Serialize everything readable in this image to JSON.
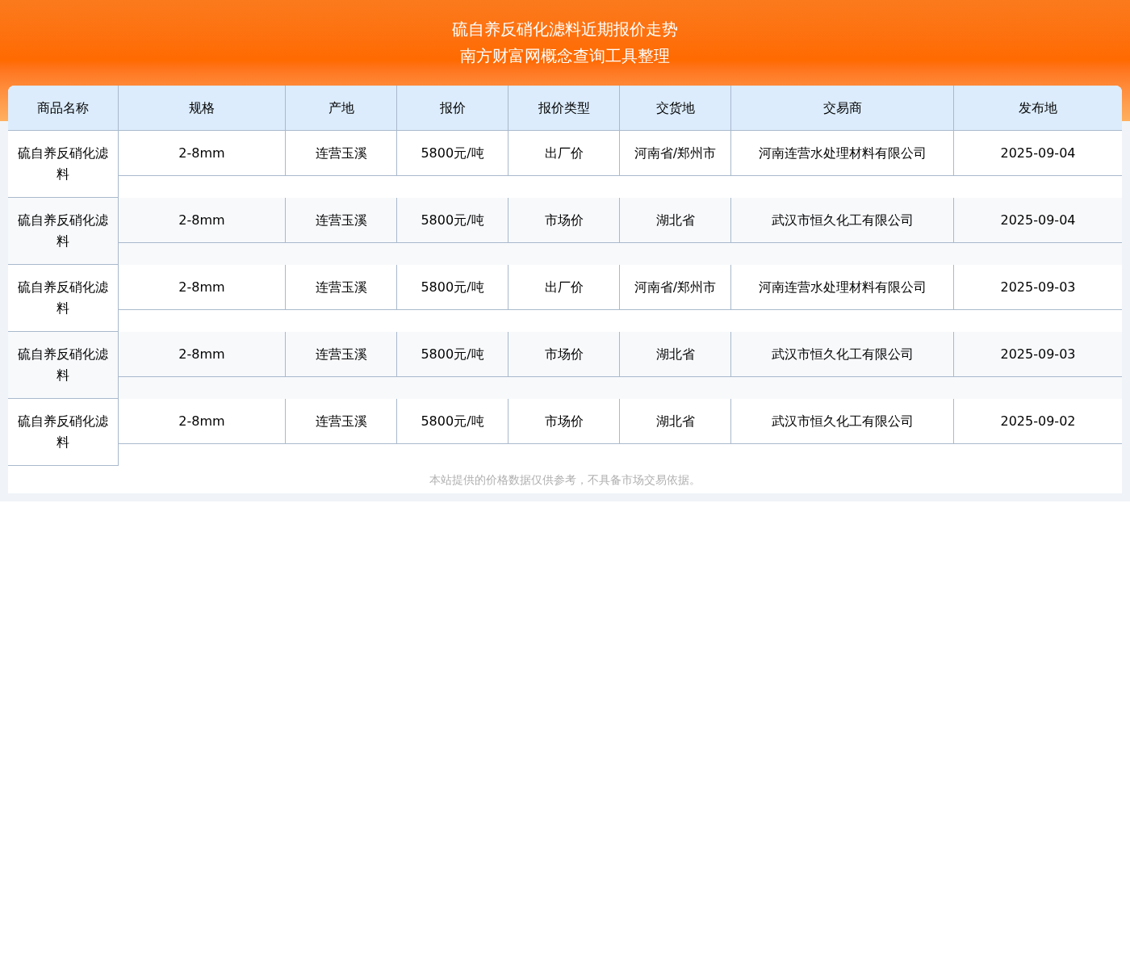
{
  "title_lines": [
    "硫自养反硝化滤料近期报价走势",
    "南方财富网概念查询工具整理"
  ],
  "table": {
    "columns": [
      "商品名称",
      "规格",
      "产地",
      "报价",
      "报价类型",
      "交货地",
      "交易商",
      "发布地"
    ],
    "rows": [
      [
        "硫自养反硝化滤料",
        "2-8mm",
        "连营玉溪",
        "5800元/吨",
        "出厂价",
        "河南省/郑州市",
        "河南连营水处理材料有限公司",
        "2025-09-04"
      ],
      [
        "硫自养反硝化滤料",
        "2-8mm",
        "连营玉溪",
        "5800元/吨",
        "市场价",
        "湖北省",
        "武汉市恒久化工有限公司",
        "2025-09-04"
      ],
      [
        "硫自养反硝化滤料",
        "2-8mm",
        "连营玉溪",
        "5800元/吨",
        "出厂价",
        "河南省/郑州市",
        "河南连营水处理材料有限公司",
        "2025-09-03"
      ],
      [
        "硫自养反硝化滤料",
        "2-8mm",
        "连营玉溪",
        "5800元/吨",
        "市场价",
        "湖北省",
        "武汉市恒久化工有限公司",
        "2025-09-03"
      ],
      [
        "硫自养反硝化滤料",
        "2-8mm",
        "连营玉溪",
        "5800元/吨",
        "市场价",
        "湖北省",
        "武汉市恒久化工有限公司",
        "2025-09-02"
      ]
    ]
  },
  "footer_note": "本站提供的价格数据仅供参考，不具备市场交易依据。"
}
